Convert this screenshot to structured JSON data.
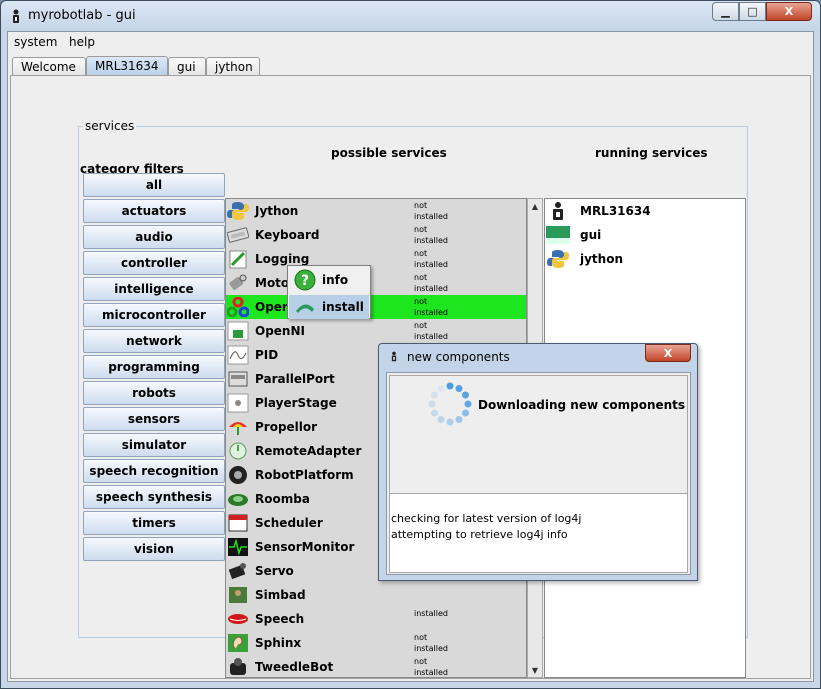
{
  "window": {
    "title": "myrobotlab - gui",
    "minimize": "▁",
    "maximize": "□",
    "close": "X"
  },
  "menubar": {
    "items": [
      "system",
      "help"
    ]
  },
  "tabs": [
    "Welcome",
    "MRL31634",
    "gui",
    "jython"
  ],
  "services": {
    "group_title": "services",
    "category_heading": "category filters",
    "possible_heading": "possible services",
    "running_heading": "running services",
    "filters": [
      "all",
      "actuators",
      "audio",
      "controller",
      "intelligence",
      "microcontroller",
      "network",
      "programming",
      "robots",
      "sensors",
      "simulator",
      "speech recognition",
      "speech synthesis",
      "timers",
      "vision"
    ],
    "possible": [
      {
        "name": "Jython",
        "status1": "not",
        "status2": "installed",
        "icon": "python-icon"
      },
      {
        "name": "Keyboard",
        "status1": "not",
        "status2": "installed",
        "icon": "keyboard-icon"
      },
      {
        "name": "Logging",
        "status1": "not",
        "status2": "installed",
        "icon": "logging-icon"
      },
      {
        "name": "Motor",
        "status1": "not",
        "status2": "installed",
        "icon": "motor-icon"
      },
      {
        "name": "OpenCV",
        "status1": "not",
        "status2": "installed",
        "icon": "opencv-icon"
      },
      {
        "name": "OpenNI",
        "status1": "not",
        "status2": "installed",
        "icon": "openni-icon"
      },
      {
        "name": "PID",
        "status1": "not",
        "status2": "installed",
        "icon": "pid-icon"
      },
      {
        "name": "ParallelPort",
        "status1": "not",
        "status2": "installed",
        "icon": "parallel-port-icon"
      },
      {
        "name": "PlayerStage",
        "status1": "",
        "status2": "",
        "icon": "player-stage-icon"
      },
      {
        "name": "Propellor",
        "status1": "",
        "status2": "",
        "icon": "propellor-icon"
      },
      {
        "name": "RemoteAdapter",
        "status1": "",
        "status2": "",
        "icon": "remote-adapter-icon"
      },
      {
        "name": "RobotPlatform",
        "status1": "",
        "status2": "",
        "icon": "robot-platform-icon"
      },
      {
        "name": "Roomba",
        "status1": "",
        "status2": "",
        "icon": "roomba-icon"
      },
      {
        "name": "Scheduler",
        "status1": "",
        "status2": "",
        "icon": "scheduler-icon"
      },
      {
        "name": "SensorMonitor",
        "status1": "",
        "status2": "",
        "icon": "sensor-monitor-icon"
      },
      {
        "name": "Servo",
        "status1": "",
        "status2": "",
        "icon": "servo-icon"
      },
      {
        "name": "Simbad",
        "status1": "",
        "status2": "",
        "icon": "simbad-icon"
      },
      {
        "name": "Speech",
        "status1": "",
        "status2": "installed",
        "icon": "speech-icon"
      },
      {
        "name": "Sphinx",
        "status1": "not",
        "status2": "installed",
        "icon": "sphinx-icon"
      },
      {
        "name": "TweedleBot",
        "status1": "not",
        "status2": "installed",
        "icon": "tweedlebot-icon"
      }
    ],
    "running": [
      {
        "name": "MRL31634",
        "icon": "mrl-icon"
      },
      {
        "name": "gui",
        "icon": "gui-icon"
      },
      {
        "name": "jython",
        "icon": "python-icon"
      }
    ]
  },
  "context_menu": {
    "items": [
      "info",
      "install"
    ]
  },
  "dialog": {
    "title": "new components",
    "close": "X",
    "message": "Downloading new components",
    "log": [
      "checking for latest version of log4j",
      "attempting to retrieve log4j info"
    ]
  },
  "colors": {
    "selected_row": "#1ee61e",
    "highlight": "#b8cfe8",
    "close_button": "#c0452a"
  }
}
